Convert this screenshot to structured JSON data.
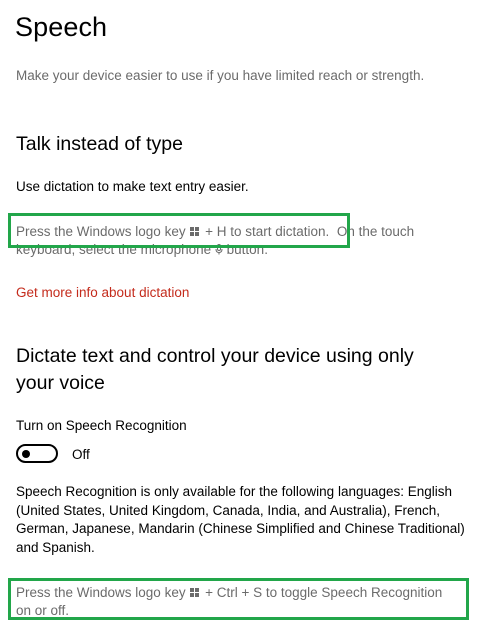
{
  "page": {
    "title": "Speech",
    "subtitle": "Make your device easier to use if you have limited reach or strength."
  },
  "talk_section": {
    "heading": "Talk instead of type",
    "description": "Use dictation to make text entry easier.",
    "hint_part1": "Press the Windows logo key",
    "hint_part2": "+ H to start dictation.",
    "hint_part3": "On the touch",
    "hint_line2_part1": "keyboard, select the microphone",
    "hint_line2_part2": "button.",
    "link": "Get more info about dictation"
  },
  "dictate_section": {
    "heading": "Dictate text and control your device using only your voice",
    "toggle_label": "Turn on Speech Recognition",
    "toggle_state": "Off",
    "toggle_on": false,
    "languages_text": "Speech Recognition is only available for the following languages: English (United States, United Kingdom, Canada, India, and Australia), French, German, Japanese, Mandarin (Chinese Simplified and Chinese Traditional) and Spanish.",
    "hint_part1": "Press the Windows logo key",
    "hint_part2": "+ Ctrl + S to toggle Speech Recognition",
    "hint_line2": "on or off."
  },
  "icons": {
    "windows_key": "windows-logo-icon",
    "microphone": "microphone-icon"
  },
  "colors": {
    "highlight": "#22a64a",
    "link": "#c42b1c",
    "secondary_text": "#6b6b6b"
  }
}
